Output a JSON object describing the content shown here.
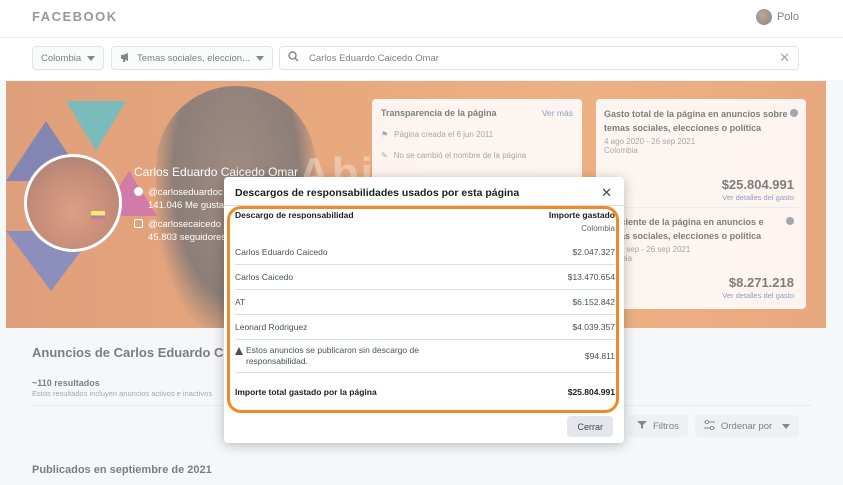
{
  "header": {
    "logo": "FACEBOOK",
    "user_name": "Polo"
  },
  "filters": {
    "country": "Colombia",
    "category": "Temas sociales, eleccion...",
    "search_value": "Carlos Eduardo Caicedo Omar"
  },
  "hero": {
    "page_name": "Carlos Eduardo Caicedo Omar",
    "facebook_handle": "@carloseduardoc",
    "facebook_likes": "141.046 Me gusta",
    "instagram_handle": "@carlosecaicedo",
    "instagram_followers": "45.803 seguidores",
    "banner_text": "Abi",
    "transparency": {
      "title": "Transparencia de la página",
      "see_more": "Ver más",
      "created": "Página creada el 6 jun 2011",
      "name_change": "No se cambió el nombre de la página"
    },
    "spend_total": {
      "title": "Gasto total de la página en anuncios sobre temas sociales, elecciones o política",
      "dates": "4 ago 2020 - 26 sep 2021",
      "country": "Colombia",
      "amount": "$25.804.991",
      "link": "Ver detalles del gasto"
    },
    "spend_recent": {
      "title": "o reciente de la página en anuncios e temas sociales, elecciones o política",
      "dates": "20 de sep - 26 sep 2021",
      "country": "olombia",
      "amount": "$8.271.218",
      "link": "Ver detalles del gasto"
    }
  },
  "results": {
    "title": "Anuncios de Carlos Eduardo Cai",
    "count": "~110 resultados",
    "note": "Estos resultados incluyen anuncios activos e inactivos",
    "filters_button": "Filtros",
    "sort_button": "Ordenar por",
    "published": "Publicados en septiembre de 2021"
  },
  "modal": {
    "title": "Descargos de responsabilidades usados por esta página",
    "col_disclaimer": "Descargo de responsabilidad",
    "col_amount": "Importe gastado",
    "col_amount_sub": "Colombia",
    "rows": [
      {
        "name": "Carlos Eduardo Caicedo",
        "amount": "$2.047.327"
      },
      {
        "name": "Carlos Caicedo",
        "amount": "$13.470.654"
      },
      {
        "name": "AT",
        "amount": "$6.152.842"
      },
      {
        "name": "Leonard Rodriguez",
        "amount": "$4.039.357"
      }
    ],
    "no_disclaimer": {
      "text": "Estos anuncios se publicaron sin descargo de responsabilidad.",
      "amount": "$94.811"
    },
    "total_label": "Importe total gastado por la página",
    "total_amount": "$25.804.991",
    "close_button": "Cerrar"
  },
  "colors": {
    "accent_orange": "#f08a24",
    "link_blue": "#385898",
    "hero_orange": "#d76a22"
  }
}
